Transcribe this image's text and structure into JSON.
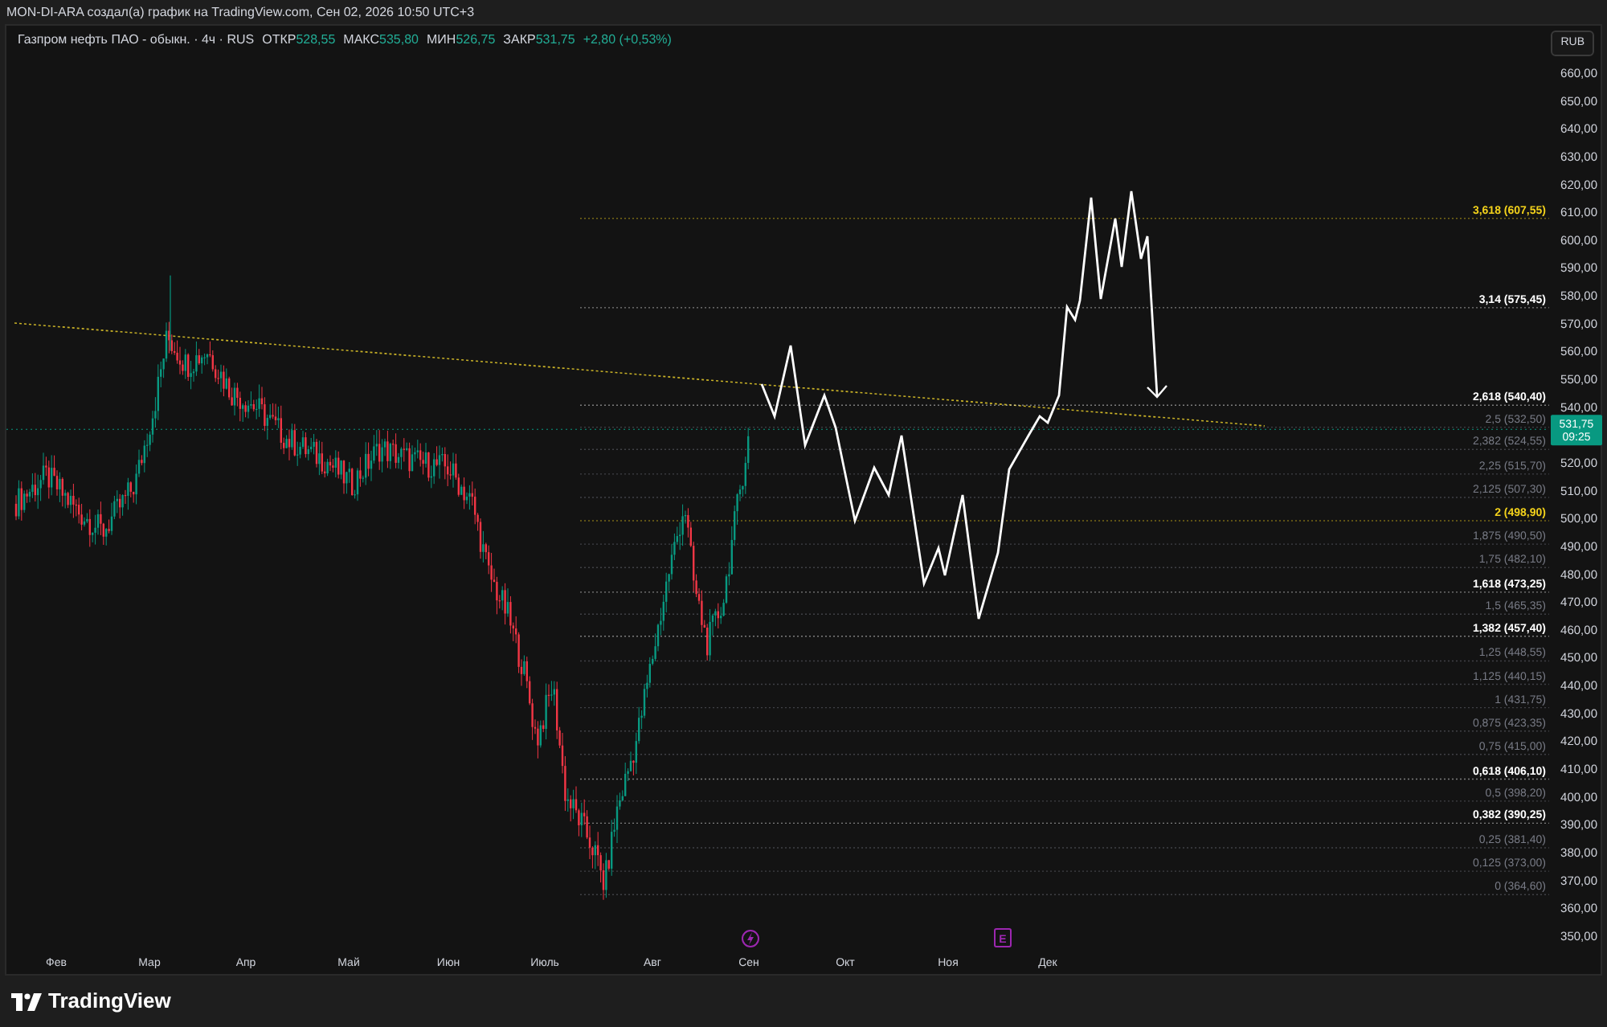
{
  "header": {
    "text": "MON-DI-ARA создал(а) график на TradingView.com, Сен 02, 2026 10:50 UTC+3"
  },
  "chart": {
    "symbol": "Газпром нефть ПАО - обыкн. · 4ч · RUS",
    "ohlc": [
      {
        "label": "ОТКР",
        "value": "528,55"
      },
      {
        "label": "МАКС",
        "value": "535,80"
      },
      {
        "label": "МИН",
        "value": "526,75"
      },
      {
        "label": "ЗАКР",
        "value": "531,75"
      }
    ],
    "change": "+2,80 (+0,53%)",
    "currency_button": "RUB",
    "price_axis": [
      "660,00",
      "650,00",
      "640,00",
      "630,00",
      "620,00",
      "610,00",
      "600,00",
      "590,00",
      "580,00",
      "570,00",
      "560,00",
      "550,00",
      "540,00",
      "520,00",
      "510,00",
      "500,00",
      "490,00",
      "480,00",
      "470,00",
      "460,00",
      "450,00",
      "440,00",
      "430,00",
      "420,00",
      "410,00",
      "400,00",
      "390,00",
      "380,00",
      "370,00",
      "360,00",
      "350,00"
    ],
    "last_price": {
      "price": "531,75",
      "countdown": "09:25"
    },
    "fib_levels": [
      {
        "label": "3,618 (607,55)",
        "color": "#f2d11b"
      },
      {
        "label": "3,14 (575,45)",
        "color": "#ffffff"
      },
      {
        "label": "2,618 (540,40)",
        "color": "#ffffff"
      },
      {
        "label": "2,5 (532,50)",
        "color": "#787b86"
      },
      {
        "label": "2,382 (524,55)",
        "color": "#787b86"
      },
      {
        "label": "2,25 (515,70)",
        "color": "#787b86"
      },
      {
        "label": "2,125 (507,30)",
        "color": "#787b86"
      },
      {
        "label": "2 (498,90)",
        "color": "#f2d11b"
      },
      {
        "label": "1,875 (490,50)",
        "color": "#787b86"
      },
      {
        "label": "1,75 (482,10)",
        "color": "#787b86"
      },
      {
        "label": "1,618 (473,25)",
        "color": "#ffffff"
      },
      {
        "label": "1,5 (465,35)",
        "color": "#787b86"
      },
      {
        "label": "1,382 (457,40)",
        "color": "#ffffff"
      },
      {
        "label": "1,25 (448,55)",
        "color": "#787b86"
      },
      {
        "label": "1,125 (440,15)",
        "color": "#787b86"
      },
      {
        "label": "1 (431,75)",
        "color": "#787b86"
      },
      {
        "label": "0,875 (423,35)",
        "color": "#787b86"
      },
      {
        "label": "0,75 (415,00)",
        "color": "#787b86"
      },
      {
        "label": "0,618 (406,10)",
        "color": "#ffffff"
      },
      {
        "label": "0,5 (398,20)",
        "color": "#787b86"
      },
      {
        "label": "0,382 (390,25)",
        "color": "#ffffff"
      },
      {
        "label": "0,25 (381,40)",
        "color": "#787b86"
      },
      {
        "label": "0,125 (373,00)",
        "color": "#787b86"
      },
      {
        "label": "0 (364,60)",
        "color": "#787b86"
      }
    ],
    "time_axis": [
      "Фев",
      "Мар",
      "Апр",
      "Май",
      "Июн",
      "Июль",
      "Авг",
      "Сен",
      "Окт",
      "Ноя",
      "Дек"
    ],
    "events": [
      {
        "kind": "bolt"
      },
      {
        "kind": "letter",
        "text": "E"
      }
    ]
  },
  "footer": {
    "logo_text": "TradingView"
  }
}
